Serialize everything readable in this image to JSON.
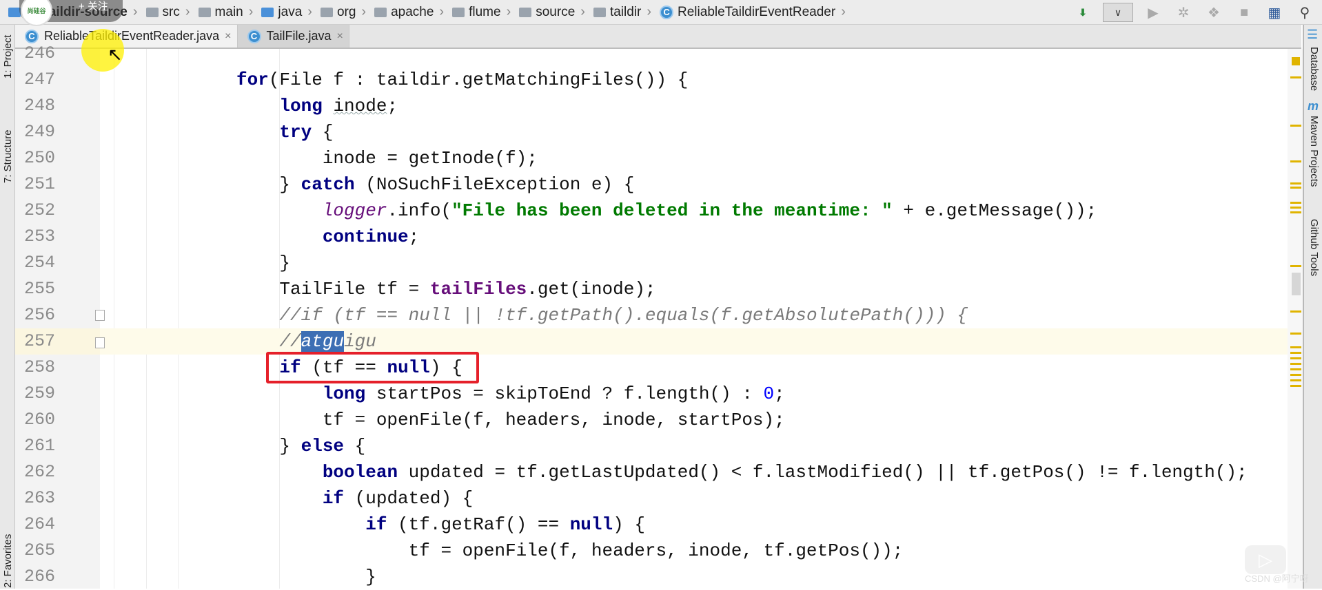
{
  "breadcrumb": [
    {
      "label": "ne-taildir-source",
      "icon": "module-folder-icon"
    },
    {
      "label": "src",
      "icon": "folder-icon"
    },
    {
      "label": "main",
      "icon": "folder-icon"
    },
    {
      "label": "java",
      "icon": "source-folder-icon"
    },
    {
      "label": "org",
      "icon": "package-icon"
    },
    {
      "label": "apache",
      "icon": "package-icon"
    },
    {
      "label": "flume",
      "icon": "package-icon"
    },
    {
      "label": "source",
      "icon": "package-icon"
    },
    {
      "label": "taildir",
      "icon": "package-icon"
    },
    {
      "label": "ReliableTaildirEventReader",
      "icon": "class-icon"
    }
  ],
  "class_icon_letter": "C",
  "toolbar": {
    "dropdown_icon": "chevron-down-icon",
    "buttons": [
      "build-icon",
      "run-icon",
      "debug-icon",
      "coverage-icon",
      "stop-icon",
      "project-structure-icon",
      "search-icon"
    ]
  },
  "tabs": [
    {
      "label": "ReliableTaildirEventReader.java",
      "active": true,
      "close": "×"
    },
    {
      "label": "TailFile.java",
      "active": false,
      "close": "×"
    }
  ],
  "left_tools": [
    "1: Project",
    "7: Structure",
    "2: Favorites"
  ],
  "right_tools": [
    "Database",
    "Maven Projects",
    "Github Tools"
  ],
  "overlay": {
    "follow": "+ 关注",
    "avatar": "尚硅谷",
    "watermark": "CSDN @阿宁呀"
  },
  "colors": {
    "keyword": "#000080",
    "string": "#007a00",
    "comment": "#7a7a7a",
    "highlight_box": "#e5202a",
    "selection": "#3d6fb4"
  },
  "code": {
    "current_line": 257,
    "highlighted_line": 258,
    "lines": [
      {
        "n": "246",
        "t": []
      },
      {
        "n": "247",
        "t": [
          [
            "kw",
            "for"
          ],
          [
            "",
            "(File f : taildir.getMatchingFiles()) {"
          ]
        ]
      },
      {
        "n": "248",
        "t": [
          [
            "",
            "    "
          ],
          [
            "kw",
            "long"
          ],
          [
            "",
            " "
          ],
          [
            "wavy",
            "inode"
          ],
          [
            "",
            ";"
          ]
        ]
      },
      {
        "n": "249",
        "t": [
          [
            "",
            "    "
          ],
          [
            "kw",
            "try"
          ],
          [
            "",
            " {"
          ]
        ]
      },
      {
        "n": "250",
        "t": [
          [
            "",
            "        inode = getInode(f);"
          ]
        ]
      },
      {
        "n": "251",
        "t": [
          [
            "",
            "    } "
          ],
          [
            "kw",
            "catch"
          ],
          [
            "",
            " (NoSuchFileException e) {"
          ]
        ]
      },
      {
        "n": "252",
        "t": [
          [
            "",
            "        "
          ],
          [
            "stat",
            "logger"
          ],
          [
            "",
            ".info("
          ],
          [
            "str",
            "\"File has been deleted in the meantime: \""
          ],
          [
            "",
            " + e.getMessage());"
          ]
        ]
      },
      {
        "n": "253",
        "t": [
          [
            "",
            "        "
          ],
          [
            "kw",
            "continue"
          ],
          [
            "",
            ";"
          ]
        ]
      },
      {
        "n": "254",
        "t": [
          [
            "",
            "    }"
          ]
        ]
      },
      {
        "n": "255",
        "t": [
          [
            "",
            "    TailFile tf = "
          ],
          [
            "fld",
            "tailFiles"
          ],
          [
            "",
            ".get(inode);"
          ]
        ]
      },
      {
        "n": "256",
        "t": [
          [
            "",
            "    "
          ],
          [
            "com",
            "//if (tf == null || !tf.getPath().equals(f.getAbsolutePath())) {"
          ]
        ]
      },
      {
        "n": "257",
        "t": [
          [
            "",
            "    "
          ],
          [
            "com",
            "//"
          ],
          [
            "sel",
            "atgu"
          ],
          [
            "com",
            "igu"
          ]
        ]
      },
      {
        "n": "258",
        "t": [
          [
            "",
            "    "
          ],
          [
            "kw",
            "if"
          ],
          [
            "",
            " (tf == "
          ],
          [
            "kw",
            "null"
          ],
          [
            "",
            ") {"
          ]
        ]
      },
      {
        "n": "259",
        "t": [
          [
            "",
            "        "
          ],
          [
            "kw",
            "long"
          ],
          [
            "",
            " startPos = skipToEnd ? f.length() : "
          ],
          [
            "num",
            "0"
          ],
          [
            "",
            ";"
          ]
        ]
      },
      {
        "n": "260",
        "t": [
          [
            "",
            "        tf = openFile(f, headers, inode, startPos);"
          ]
        ]
      },
      {
        "n": "261",
        "t": [
          [
            "",
            "    } "
          ],
          [
            "kw",
            "else"
          ],
          [
            "",
            " {"
          ]
        ]
      },
      {
        "n": "262",
        "t": [
          [
            "",
            "        "
          ],
          [
            "kw",
            "boolean"
          ],
          [
            "",
            " updated = tf.getLastUpdated() < f.lastModified() || tf.getPos() != f.length();"
          ]
        ]
      },
      {
        "n": "263",
        "t": [
          [
            "",
            "        "
          ],
          [
            "kw",
            "if"
          ],
          [
            "",
            " (updated) {"
          ]
        ]
      },
      {
        "n": "264",
        "t": [
          [
            "",
            "            "
          ],
          [
            "kw",
            "if"
          ],
          [
            "",
            " (tf.getRaf() == "
          ],
          [
            "kw",
            "null"
          ],
          [
            "",
            ") {"
          ]
        ]
      },
      {
        "n": "265",
        "t": [
          [
            "",
            "                tf = openFile(f, headers, inode, tf.getPos());"
          ]
        ]
      },
      {
        "n": "266",
        "t": [
          [
            "",
            "            }"
          ]
        ]
      }
    ]
  }
}
